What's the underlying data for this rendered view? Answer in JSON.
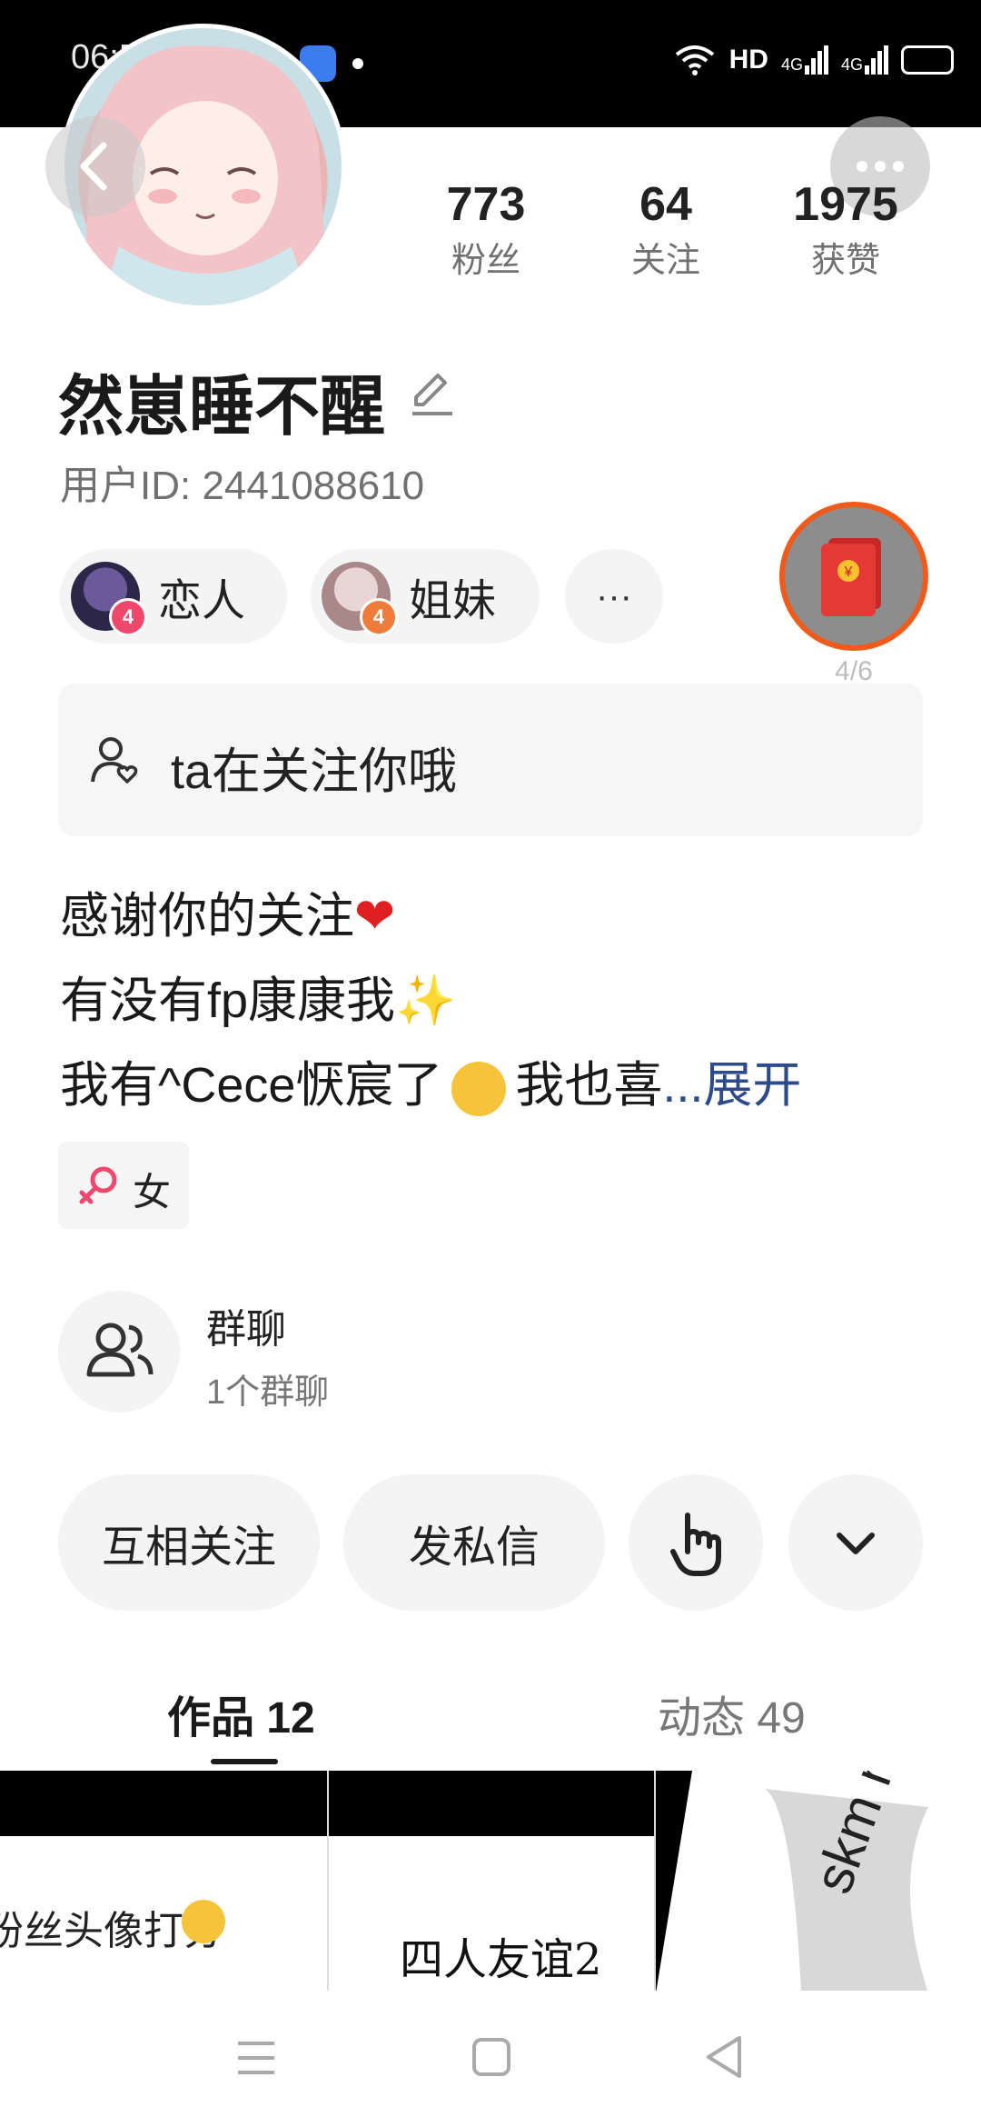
{
  "status_bar": {
    "time": "06:57",
    "network": "HD",
    "signal_1": "4G",
    "signal_2": "4G"
  },
  "profile": {
    "stats": [
      {
        "value": "773",
        "label": "粉丝"
      },
      {
        "value": "64",
        "label": "关注"
      },
      {
        "value": "1975",
        "label": "获赞"
      }
    ],
    "name": "然崽睡不醒",
    "user_id": "用户ID: 2441088610",
    "relations": [
      {
        "label": "恋人",
        "badge": "4",
        "badge_color": "#f0486c"
      },
      {
        "label": "姐妹",
        "badge": "4",
        "badge_color": "#f07c3c"
      }
    ],
    "more_label": "···",
    "red_packet_progress": "4/6",
    "follow_notice": "ta在关注你哦",
    "bio": {
      "line1": "感谢你的关注",
      "line2": "有没有fp康康我",
      "line3": "我有^Cece恹宸了",
      "line3_tail": "我也喜",
      "expand": "...展开"
    },
    "gender": "女",
    "group_chat": {
      "title": "群聊",
      "subtitle": "1个群聊"
    }
  },
  "actions": {
    "mutual_follow": "互相关注",
    "message": "发私信"
  },
  "tabs": [
    {
      "label": "作品 12",
      "active": true
    },
    {
      "label": "动态 49",
      "active": false
    }
  ],
  "tiles": [
    {
      "caption": "粉丝头像打分"
    },
    {
      "caption": "四人友谊2"
    },
    {
      "caption": "skm n"
    }
  ],
  "colors": {
    "accent_link": "#2d4a8a",
    "red_packet": "#e53935",
    "ring": "#f05a1a",
    "gender_pink": "#f0486c"
  }
}
